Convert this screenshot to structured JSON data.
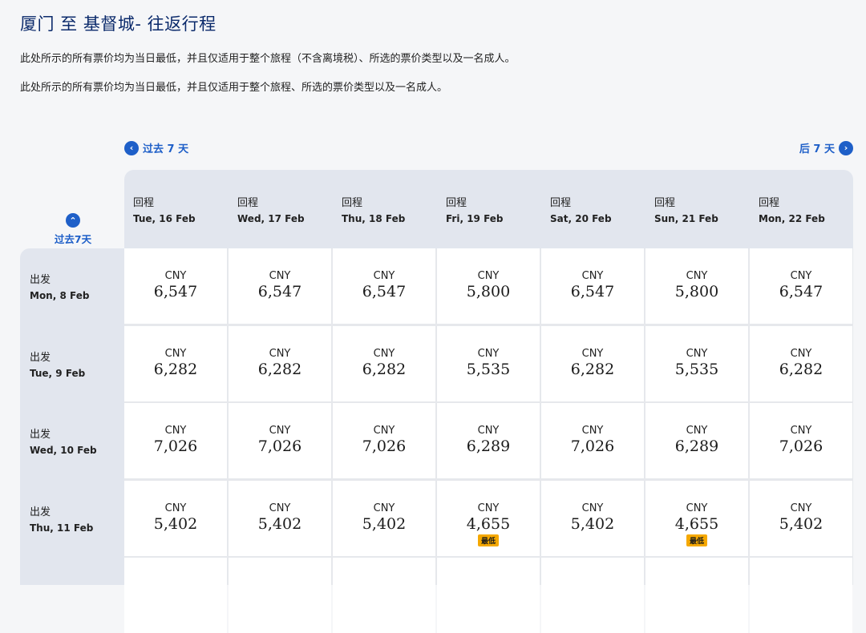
{
  "page": {
    "title": "厦门 至 基督城- 往返行程",
    "note1": "此处所示的所有票价均为当日最低，并且仅适用于整个旅程（不含离境税）、所选的票价类型以及一名成人。",
    "note2": "此处所示的所有票价均为当日最低，并且仅适用于整个旅程、所选的票价类型以及一名成人。"
  },
  "nav": {
    "prev_label": "过去 7 天",
    "next_label": "后 7 天",
    "prev_vertical_label": "过去7天",
    "prev_icon": "chevron-left-icon",
    "next_icon": "chevron-right-icon",
    "up_icon": "chevron-up-icon"
  },
  "columns": [
    {
      "label": "回程",
      "date": "Tue, 16 Feb"
    },
    {
      "label": "回程",
      "date": "Wed, 17 Feb"
    },
    {
      "label": "回程",
      "date": "Thu, 18 Feb"
    },
    {
      "label": "回程",
      "date": "Fri, 19 Feb"
    },
    {
      "label": "回程",
      "date": "Sat, 20 Feb"
    },
    {
      "label": "回程",
      "date": "Sun, 21 Feb"
    },
    {
      "label": "回程",
      "date": "Mon, 22 Feb"
    }
  ],
  "rows": [
    {
      "label": "出发",
      "date": "Mon, 8 Feb",
      "prices": [
        {
          "currency": "CNY",
          "amount": "6,547"
        },
        {
          "currency": "CNY",
          "amount": "6,547"
        },
        {
          "currency": "CNY",
          "amount": "6,547"
        },
        {
          "currency": "CNY",
          "amount": "5,800"
        },
        {
          "currency": "CNY",
          "amount": "6,547"
        },
        {
          "currency": "CNY",
          "amount": "5,800"
        },
        {
          "currency": "CNY",
          "amount": "6,547"
        }
      ]
    },
    {
      "label": "出发",
      "date": "Tue, 9 Feb",
      "prices": [
        {
          "currency": "CNY",
          "amount": "6,282"
        },
        {
          "currency": "CNY",
          "amount": "6,282"
        },
        {
          "currency": "CNY",
          "amount": "6,282"
        },
        {
          "currency": "CNY",
          "amount": "5,535"
        },
        {
          "currency": "CNY",
          "amount": "6,282"
        },
        {
          "currency": "CNY",
          "amount": "5,535"
        },
        {
          "currency": "CNY",
          "amount": "6,282"
        }
      ]
    },
    {
      "label": "出发",
      "date": "Wed, 10 Feb",
      "prices": [
        {
          "currency": "CNY",
          "amount": "7,026"
        },
        {
          "currency": "CNY",
          "amount": "7,026"
        },
        {
          "currency": "CNY",
          "amount": "7,026"
        },
        {
          "currency": "CNY",
          "amount": "6,289"
        },
        {
          "currency": "CNY",
          "amount": "7,026"
        },
        {
          "currency": "CNY",
          "amount": "6,289"
        },
        {
          "currency": "CNY",
          "amount": "7,026"
        }
      ]
    },
    {
      "label": "出发",
      "date": "Thu, 11 Feb",
      "prices": [
        {
          "currency": "CNY",
          "amount": "5,402"
        },
        {
          "currency": "CNY",
          "amount": "5,402"
        },
        {
          "currency": "CNY",
          "amount": "5,402"
        },
        {
          "currency": "CNY",
          "amount": "4,655",
          "badge": "最低"
        },
        {
          "currency": "CNY",
          "amount": "5,402"
        },
        {
          "currency": "CNY",
          "amount": "4,655",
          "badge": "最低"
        },
        {
          "currency": "CNY",
          "amount": "5,402"
        }
      ]
    }
  ],
  "colors": {
    "accent": "#1e5fc8",
    "title": "#0b2a6b",
    "badge": "#f5a800",
    "band": "#e2e6ee",
    "background": "#f5f6f8"
  }
}
